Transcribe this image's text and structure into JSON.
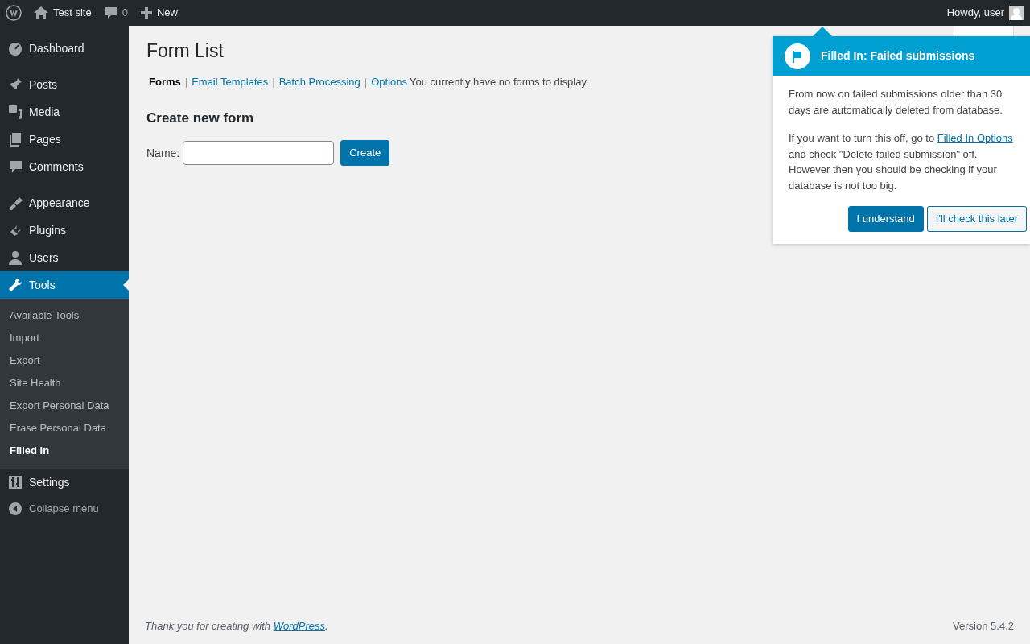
{
  "admin_bar": {
    "site": "Test site",
    "comments": "0",
    "new": "New",
    "greeting": "Howdy, user"
  },
  "menu_groups": [
    [
      {
        "label": "Dashboard",
        "selected": false
      }
    ],
    [
      {
        "label": "Posts",
        "selected": false
      },
      {
        "label": "Media",
        "selected": false
      },
      {
        "label": "Pages",
        "selected": false
      },
      {
        "label": "Comments",
        "selected": false
      }
    ],
    [
      {
        "label": "Appearance",
        "selected": false
      },
      {
        "label": "Plugins",
        "selected": false
      },
      {
        "label": "Users",
        "selected": false
      },
      {
        "label": "Tools",
        "selected": true,
        "submenu": [
          {
            "label": "Available Tools",
            "selected": false
          },
          {
            "label": "Import",
            "selected": false
          },
          {
            "label": "Export",
            "selected": false
          },
          {
            "label": "Site Health",
            "selected": false
          },
          {
            "label": "Export Personal Data",
            "selected": false
          },
          {
            "label": "Erase Personal Data",
            "selected": false
          },
          {
            "label": "Filled In",
            "selected": true
          }
        ]
      },
      {
        "label": "Settings",
        "selected": false
      }
    ]
  ],
  "collapse": "Collapse menu",
  "page": {
    "title": "Form List",
    "tabs": [
      {
        "label": "Forms",
        "selected": true
      },
      {
        "separator": "|",
        "label": "Email Templates",
        "selected": false
      },
      {
        "separator": "|",
        "label": "Batch Processing",
        "selected": false
      },
      {
        "separator": "|",
        "label": "Options",
        "selected": false
      }
    ],
    "notice": "You currently have no forms to display.",
    "section": "Create new form",
    "name_label": "Name:",
    "create_button": "Create"
  },
  "footer": {
    "thanks_before": "Thank you for creating with ",
    "thanks_link": "WordPress",
    "thanks_after": ".",
    "version": "Version 5.4.2"
  },
  "pointer": {
    "title": "Filled In: Failed submissions",
    "paragraph_1": "From now on failed submissions older than 30 days are automatically deleted from database.",
    "paragraph_2_before": "If you want to turn this off, go to ",
    "paragraph_2_link": "Filled In Options",
    "paragraph_2_after": " and check \"Delete failed submission\" off. However then you should be checking if your database is not too big.",
    "buttons": [
      {
        "label": "I understand",
        "kind": "primary"
      },
      {
        "label": "I'll check this later",
        "kind": "secondary"
      }
    ]
  }
}
